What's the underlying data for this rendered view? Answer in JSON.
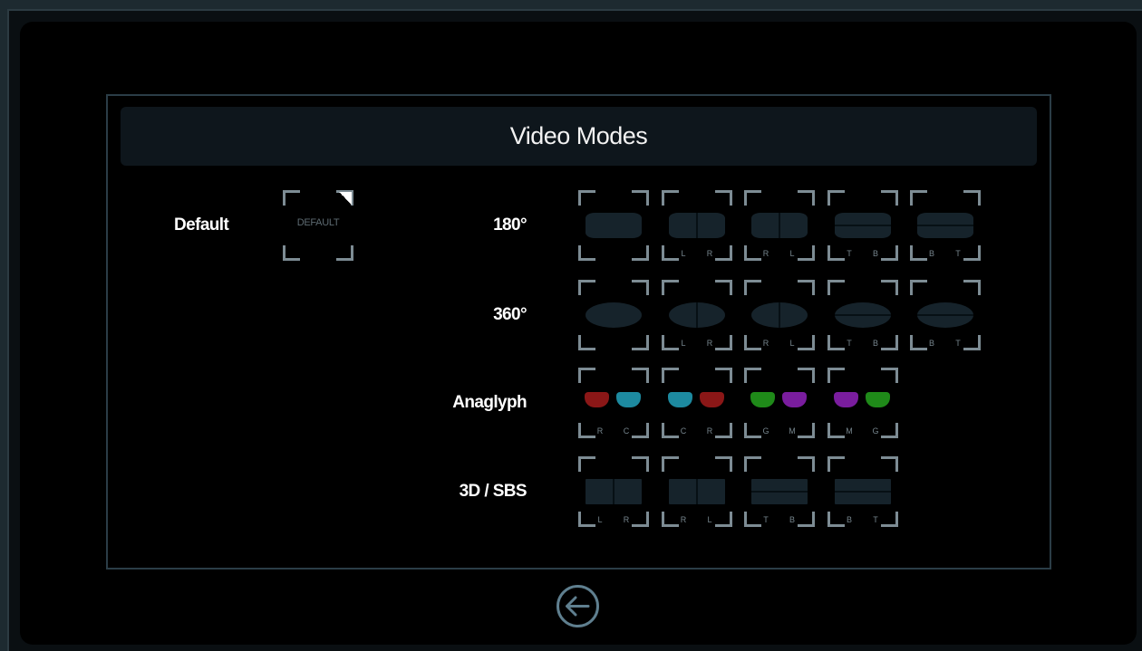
{
  "title": "Video Modes",
  "default": {
    "label": "Default",
    "tile_text": "DEFAULT"
  },
  "rows": [
    {
      "label": "180°",
      "tiles": [
        {
          "shape": "flat",
          "split": "",
          "subs": [
            "",
            ""
          ]
        },
        {
          "shape": "flat",
          "split": "v",
          "subs": [
            "L",
            "R"
          ]
        },
        {
          "shape": "flat",
          "split": "v",
          "subs": [
            "R",
            "L"
          ]
        },
        {
          "shape": "flat",
          "split": "h",
          "subs": [
            "T",
            "B"
          ]
        },
        {
          "shape": "flat",
          "split": "h",
          "subs": [
            "B",
            "T"
          ]
        }
      ]
    },
    {
      "label": "360°",
      "tiles": [
        {
          "shape": "pill",
          "split": "",
          "subs": [
            "",
            ""
          ]
        },
        {
          "shape": "pill",
          "split": "v",
          "subs": [
            "L",
            "R"
          ]
        },
        {
          "shape": "pill",
          "split": "v",
          "subs": [
            "R",
            "L"
          ]
        },
        {
          "shape": "pill",
          "split": "h",
          "subs": [
            "T",
            "B"
          ]
        },
        {
          "shape": "pill",
          "split": "h",
          "subs": [
            "B",
            "T"
          ]
        }
      ]
    },
    {
      "label": "Anaglyph",
      "tiles": [
        {
          "shape": "glasses",
          "lenses": [
            "#8b1717",
            "#1d8aa0"
          ],
          "subs": [
            "R",
            "C"
          ]
        },
        {
          "shape": "glasses",
          "lenses": [
            "#1d8aa0",
            "#8b1717"
          ],
          "subs": [
            "C",
            "R"
          ]
        },
        {
          "shape": "glasses",
          "lenses": [
            "#1f8a19",
            "#7a1d9e"
          ],
          "subs": [
            "G",
            "M"
          ]
        },
        {
          "shape": "glasses",
          "lenses": [
            "#7a1d9e",
            "#1f8a19"
          ],
          "subs": [
            "M",
            "G"
          ]
        }
      ]
    },
    {
      "label": "3D / SBS",
      "tiles": [
        {
          "shape": "rect",
          "split": "v",
          "subs": [
            "L",
            "R"
          ]
        },
        {
          "shape": "rect",
          "split": "v",
          "subs": [
            "R",
            "L"
          ]
        },
        {
          "shape": "rect",
          "split": "h",
          "subs": [
            "T",
            "B"
          ]
        },
        {
          "shape": "rect",
          "split": "h",
          "subs": [
            "B",
            "T"
          ]
        }
      ]
    }
  ],
  "back_button": {
    "icon": "back-arrow-circle-icon"
  },
  "colors": {
    "accent": "#5f7f8f",
    "tile_bracket": "#7d8c94",
    "tile_fill": "#16232b"
  }
}
